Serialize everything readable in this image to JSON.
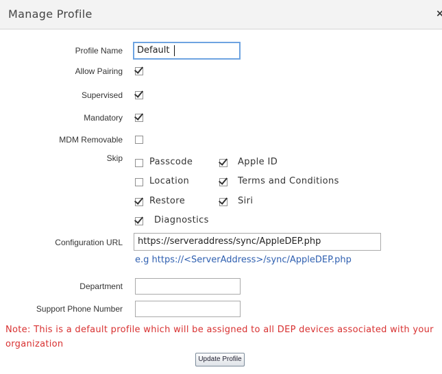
{
  "dialog": {
    "title": "Manage Profile",
    "close_glyph": "×"
  },
  "form": {
    "profile_name": {
      "label": "Profile Name",
      "value": "Default"
    },
    "allow_pairing": {
      "label": "Allow Pairing",
      "checked": true
    },
    "supervised": {
      "label": "Supervised",
      "checked": true
    },
    "mandatory": {
      "label": "Mandatory",
      "checked": true
    },
    "mdm_removable": {
      "label": "MDM Removable",
      "checked": false
    },
    "skip": {
      "label": "Skip",
      "options": [
        {
          "label": "Passcode",
          "checked": false
        },
        {
          "label": "Apple ID",
          "checked": true
        },
        {
          "label": "Location",
          "checked": false
        },
        {
          "label": "Terms and Conditions",
          "checked": true
        },
        {
          "label": "Restore",
          "checked": true
        },
        {
          "label": "Siri",
          "checked": true
        },
        {
          "label": "Diagnostics",
          "checked": true
        }
      ]
    },
    "configuration_url": {
      "label": "Configuration URL",
      "value": "https://serveraddress/sync/AppleDEP.php",
      "hint": "e.g https://<ServerAddress>/sync/AppleDEP.php"
    },
    "department": {
      "label": "Department",
      "value": ""
    },
    "support_phone": {
      "label": "Support Phone Number",
      "value": ""
    }
  },
  "note": "Note: This is a default profile which will be assigned to all DEP devices associated with your organization",
  "update_button": "Update Profile",
  "colors": {
    "note": "#d83030",
    "hint": "#2e5fb0",
    "focus_border": "#6da3e1"
  }
}
